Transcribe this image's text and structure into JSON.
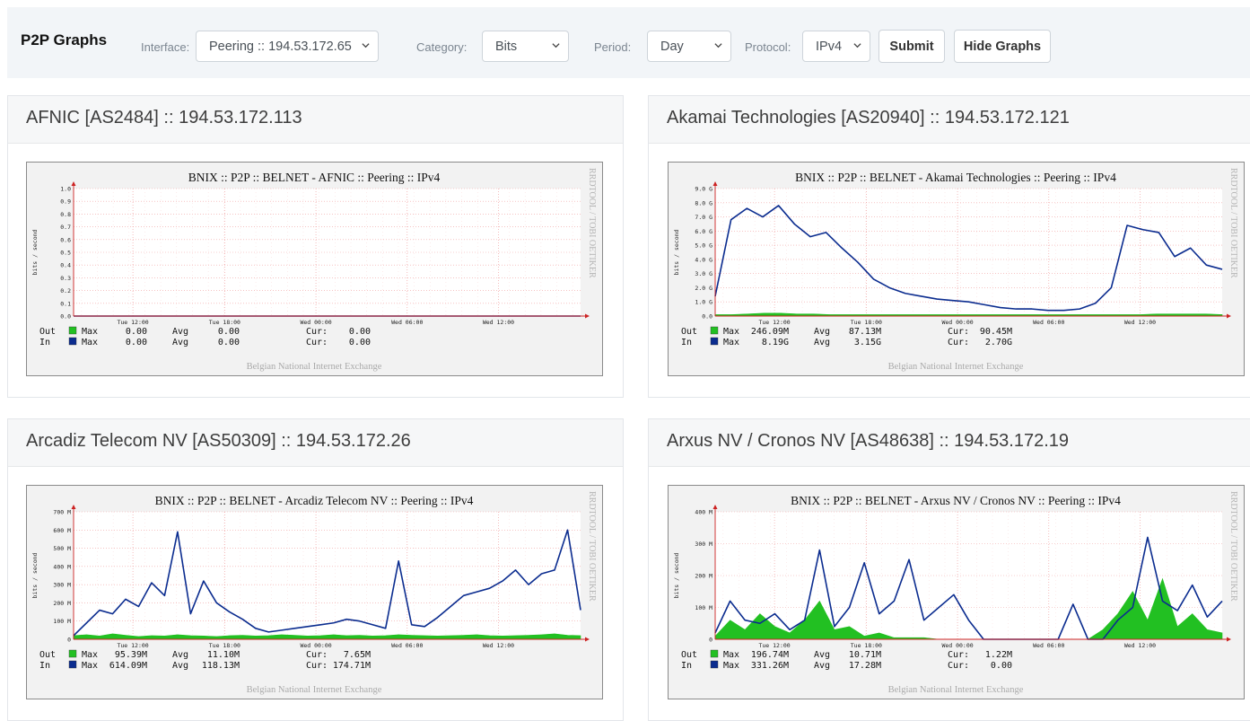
{
  "header": {
    "title": "P2P Graphs",
    "interface": {
      "label": "Interface:",
      "value": "Peering :: 194.53.172.65"
    },
    "category": {
      "label": "Category:",
      "value": "Bits"
    },
    "period": {
      "label": "Period:",
      "value": "Day"
    },
    "protocol": {
      "label": "Protocol:",
      "value": "IPv4"
    },
    "submit_label": "Submit",
    "hide_label": "Hide Graphs"
  },
  "colors": {
    "out": "#22c022",
    "in": "#0b2c8f",
    "grid": "#f0a0a0",
    "axis": "#cc2222"
  },
  "common": {
    "ylabel": "bits / second",
    "footer": "Belgian National Internet Exchange",
    "watermark": "RRDTOOL / TOBI OETIKER",
    "x_ticks": [
      "Tue 12:00",
      "Tue 18:00",
      "Wed 00:00",
      "Wed 06:00",
      "Wed 12:00"
    ],
    "legend_labels": {
      "out": "Out",
      "in": "In",
      "max": "Max",
      "avg": "Avg",
      "cur": "Cur:"
    }
  },
  "panels": [
    {
      "heading": "AFNIC [AS2484] :: 194.53.172.113",
      "graph_title": "BNIX :: P2P :: BELNET - AFNIC :: Peering :: IPv4",
      "y_ticks": [
        "1.0",
        "0.9",
        "0.8",
        "0.7",
        "0.6",
        "0.5",
        "0.4",
        "0.3",
        "0.2",
        "0.1",
        "0.0"
      ],
      "stats": {
        "out": {
          "max": "0.00",
          "avg": "0.00",
          "cur": "0.00"
        },
        "in": {
          "max": "0.00",
          "avg": "0.00",
          "cur": "0.00"
        }
      },
      "chart_data": {
        "type": "area",
        "ylim": [
          0,
          1.0
        ],
        "series": [
          {
            "name": "Out",
            "values": [
              0,
              0,
              0,
              0,
              0,
              0,
              0,
              0,
              0,
              0
            ]
          },
          {
            "name": "In",
            "values": [
              0,
              0,
              0,
              0,
              0,
              0,
              0,
              0,
              0,
              0
            ]
          }
        ]
      }
    },
    {
      "heading": "Akamai Technologies [AS20940] :: 194.53.172.121",
      "graph_title": "BNIX :: P2P :: BELNET - Akamai Technologies :: Peering :: IPv4",
      "y_ticks": [
        "9.0 G",
        "8.0 G",
        "7.0 G",
        "6.0 G",
        "5.0 G",
        "4.0 G",
        "3.0 G",
        "2.0 G",
        "1.0 G",
        "0.0"
      ],
      "stats": {
        "out": {
          "max": "246.09M",
          "avg": "87.13M",
          "cur": "90.45M"
        },
        "in": {
          "max": "8.19G",
          "avg": "3.15G",
          "cur": "2.70G"
        }
      },
      "chart_data": {
        "type": "line",
        "ylim": [
          0,
          9.0
        ],
        "series": [
          {
            "name": "Out",
            "values": [
              0.1,
              0.1,
              0.15,
              0.2,
              0.2,
              0.15,
              0.15,
              0.1,
              0.1,
              0.1,
              0.1,
              0.1,
              0.1,
              0.1,
              0.1,
              0.1,
              0.1,
              0.1,
              0.1,
              0.1,
              0.1,
              0.1,
              0.1,
              0.1,
              0.1,
              0.1,
              0.1,
              0.15,
              0.15,
              0.15,
              0.15,
              0.1
            ]
          },
          {
            "name": "In",
            "values": [
              1.4,
              6.8,
              7.6,
              7.0,
              7.8,
              6.5,
              5.6,
              5.9,
              4.8,
              3.8,
              2.6,
              2.0,
              1.6,
              1.4,
              1.2,
              1.1,
              1.0,
              0.8,
              0.6,
              0.5,
              0.5,
              0.4,
              0.4,
              0.5,
              0.9,
              2.0,
              6.4,
              6.1,
              5.9,
              4.2,
              4.8,
              3.6,
              3.3
            ]
          }
        ]
      }
    },
    {
      "heading": "Arcadiz Telecom NV [AS50309] :: 194.53.172.26",
      "graph_title": "BNIX :: P2P :: BELNET - Arcadiz Telecom NV :: Peering :: IPv4",
      "y_ticks": [
        "700 M",
        "600 M",
        "500 M",
        "400 M",
        "300 M",
        "200 M",
        "100 M",
        "0"
      ],
      "stats": {
        "out": {
          "max": "95.39M",
          "avg": "11.10M",
          "cur": "7.65M"
        },
        "in": {
          "max": "614.09M",
          "avg": "118.13M",
          "cur": "174.71M"
        }
      },
      "chart_data": {
        "type": "line",
        "ylim": [
          0,
          700
        ],
        "series": [
          {
            "name": "Out",
            "values": [
              20,
              25,
              18,
              30,
              22,
              15,
              20,
              18,
              25,
              20,
              18,
              15,
              20,
              22,
              18,
              20,
              25,
              22,
              18,
              20,
              25,
              20,
              22,
              18,
              20,
              25,
              22,
              20,
              18,
              20,
              22,
              25,
              20,
              18,
              20,
              22,
              25,
              30,
              22,
              20
            ]
          },
          {
            "name": "In",
            "values": [
              20,
              90,
              160,
              140,
              220,
              180,
              310,
              240,
              590,
              140,
              320,
              200,
              150,
              110,
              60,
              40,
              50,
              60,
              70,
              80,
              90,
              110,
              100,
              80,
              60,
              430,
              80,
              70,
              120,
              180,
              240,
              260,
              280,
              320,
              380,
              300,
              360,
              380,
              600,
              160
            ]
          }
        ]
      }
    },
    {
      "heading": "Arxus NV / Cronos NV [AS48638] :: 194.53.172.19",
      "graph_title": "BNIX :: P2P :: BELNET - Arxus NV / Cronos NV :: Peering :: IPv4",
      "y_ticks": [
        "400 M",
        "300 M",
        "200 M",
        "100 M",
        "0"
      ],
      "stats": {
        "out": {
          "max": "196.74M",
          "avg": "10.71M",
          "cur": "1.22M"
        },
        "in": {
          "max": "331.26M",
          "avg": "17.28M",
          "cur": "0.00"
        }
      },
      "chart_data": {
        "type": "line",
        "ylim": [
          0,
          400
        ],
        "series": [
          {
            "name": "Out",
            "values": [
              10,
              60,
              30,
              80,
              40,
              20,
              60,
              120,
              30,
              40,
              10,
              20,
              5,
              5,
              5,
              0,
              0,
              0,
              0,
              0,
              0,
              0,
              0,
              0,
              0,
              0,
              30,
              80,
              150,
              60,
              190,
              40,
              80,
              30,
              20
            ]
          },
          {
            "name": "In",
            "values": [
              20,
              120,
              60,
              50,
              80,
              30,
              60,
              280,
              40,
              100,
              240,
              80,
              120,
              250,
              60,
              100,
              140,
              60,
              0,
              0,
              0,
              0,
              0,
              0,
              110,
              0,
              0,
              60,
              100,
              320,
              120,
              90,
              170,
              70,
              120
            ]
          }
        ]
      }
    }
  ]
}
